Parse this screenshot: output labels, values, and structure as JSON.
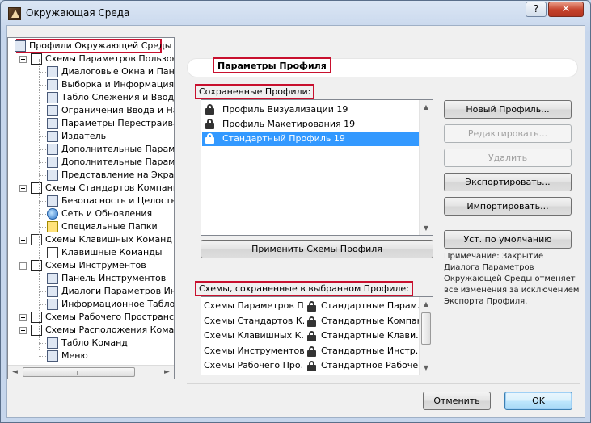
{
  "window": {
    "title": "Окружающая Среда",
    "help_label": "?",
    "close_label": "✕"
  },
  "tree": {
    "items": [
      {
        "label": "Профили Окружающей Среды",
        "level": 0,
        "icon": "profile-icon"
      },
      {
        "label": "Схемы Параметров Пользоват",
        "level": 1,
        "icon": "user-settings-icon"
      },
      {
        "label": "Диалоговые Окна и Панел",
        "level": 2,
        "icon": "dialog-icon"
      },
      {
        "label": "Выборка и Информация об",
        "level": 2,
        "icon": "selection-icon"
      },
      {
        "label": "Табло Слежения и Ввод Ко",
        "level": 2,
        "icon": "tracker-icon"
      },
      {
        "label": "Ограничения Ввода и Напр",
        "level": 2,
        "icon": "constraint-icon"
      },
      {
        "label": "Параметры Перестраивани",
        "level": 2,
        "icon": "rebuild-icon"
      },
      {
        "label": "Издатель",
        "level": 2,
        "icon": "publisher-icon"
      },
      {
        "label": "Дополнительные Парамет",
        "level": 2,
        "icon": "extra-settings-icon"
      },
      {
        "label": "Дополнительные Парамет",
        "level": 2,
        "icon": "extra-settings-icon"
      },
      {
        "label": "Представление на Экране",
        "level": 2,
        "icon": "display-icon"
      },
      {
        "label": "Схемы Стандартов Компании",
        "level": 1,
        "icon": "company-standards-icon"
      },
      {
        "label": "Безопасность и Целостнос",
        "level": 2,
        "icon": "safety-icon"
      },
      {
        "label": "Сеть и Обновления",
        "level": 2,
        "icon": "globe-icon"
      },
      {
        "label": "Специальные Папки",
        "level": 2,
        "icon": "folder-icon"
      },
      {
        "label": "Схемы Клавишных Команд",
        "level": 1,
        "icon": "shortcut-icon"
      },
      {
        "label": "Клавишные Команды",
        "level": 2,
        "icon": "key-icon"
      },
      {
        "label": "Схемы Инструментов",
        "level": 1,
        "icon": "tools-icon"
      },
      {
        "label": "Панель Инструментов",
        "level": 2,
        "icon": "toolbar-icon"
      },
      {
        "label": "Диалоги Параметров Инстр",
        "level": 2,
        "icon": "tool-dialog-icon"
      },
      {
        "label": "Информационное Табло",
        "level": 2,
        "icon": "info-box-icon"
      },
      {
        "label": "Схемы Рабочего Пространства",
        "level": 1,
        "icon": "workspace-icon"
      },
      {
        "label": "Схемы Расположения Команд",
        "level": 1,
        "icon": "command-layout-icon"
      },
      {
        "label": "Табло Команд",
        "level": 2,
        "icon": "command-table-icon"
      },
      {
        "label": "Меню",
        "level": 2,
        "icon": "menu-icon"
      }
    ],
    "scroll_left": "◄",
    "scroll_right": "►"
  },
  "panel": {
    "title": "Параметры Профиля",
    "saved_profiles_label": "Сохраненные Профили:",
    "profiles": [
      {
        "name": "Профиль Визуализации 19",
        "selected": false
      },
      {
        "name": "Профиль Макетирования 19",
        "selected": false
      },
      {
        "name": "Стандартный Профиль 19",
        "selected": true
      }
    ],
    "apply_button": "Применить Схемы Профиля",
    "buttons": {
      "new_profile": "Новый Профиль...",
      "edit": "Редактировать...",
      "delete": "Удалить",
      "export": "Экспортировать...",
      "import": "Импортировать...",
      "defaults": "Уст. по умолчанию"
    },
    "note": "Примечание: Закрытие Диалога Параметров Окружающей Среды отменяет все изменения за исключением Экспорта Профиля.",
    "schemes_label": "Схемы, сохраненные в выбранном Профиле:",
    "schemes": [
      {
        "scheme": "Схемы Параметров П...",
        "value": "Стандартные Парам..."
      },
      {
        "scheme": "Схемы Стандартов К...",
        "value": "Стандартные Компани..."
      },
      {
        "scheme": "Схемы Клавишных К...",
        "value": "Стандартные Клави..."
      },
      {
        "scheme": "Схемы Инструментов",
        "value": "Стандартные Инстр..."
      },
      {
        "scheme": "Схемы Рабочего Про...",
        "value": "Стандартное Рабоче..."
      },
      {
        "scheme": "",
        "value": ""
      }
    ],
    "scroll_up": "▲",
    "scroll_down": "▼"
  },
  "footer": {
    "cancel": "Отменить",
    "ok": "OK"
  },
  "colors": {
    "highlight_box": "#c8102e",
    "selection": "#3399ff"
  }
}
